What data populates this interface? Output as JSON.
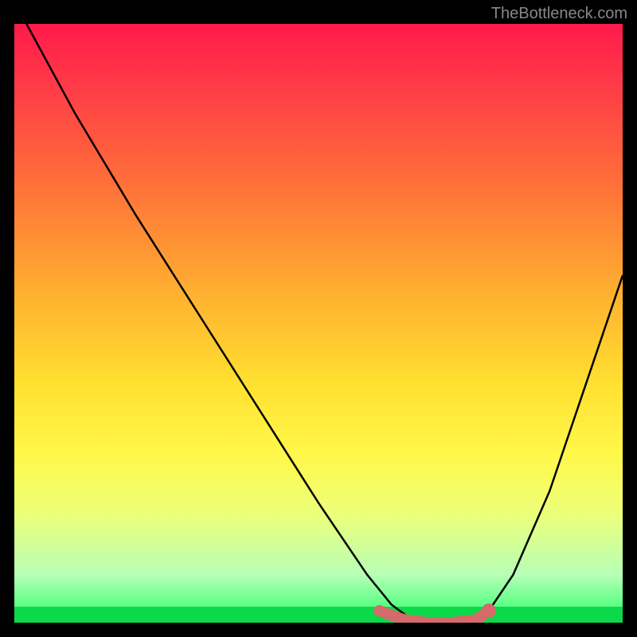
{
  "watermark": "TheBottleneck.com",
  "plot": {
    "x_range": [
      0,
      100
    ],
    "y_range": [
      0,
      100
    ],
    "gradient_stops": [
      {
        "pos": 0,
        "color": "#ff1a4a"
      },
      {
        "pos": 10,
        "color": "#ff3a48"
      },
      {
        "pos": 25,
        "color": "#ff6a3a"
      },
      {
        "pos": 45,
        "color": "#ffb030"
      },
      {
        "pos": 60,
        "color": "#ffe030"
      },
      {
        "pos": 72,
        "color": "#fff84a"
      },
      {
        "pos": 82,
        "color": "#ecff7a"
      },
      {
        "pos": 92,
        "color": "#b6ffb6"
      },
      {
        "pos": 100,
        "color": "#2aff6a"
      }
    ]
  },
  "chart_data": {
    "type": "line",
    "title": "",
    "xlabel": "",
    "ylabel": "",
    "xlim": [
      0,
      100
    ],
    "ylim": [
      0,
      100
    ],
    "series": [
      {
        "name": "curve",
        "x": [
          2,
          10,
          20,
          30,
          40,
          50,
          58,
          62,
          66,
          70,
          74,
          78,
          82,
          88,
          94,
          100
        ],
        "y": [
          100,
          85,
          68,
          52,
          36,
          20,
          8,
          3,
          0,
          0,
          0,
          2,
          8,
          22,
          40,
          58
        ]
      }
    ],
    "highlight": {
      "name": "optimal-zone",
      "color": "#d46a6a",
      "x": [
        60,
        64,
        68,
        72,
        76,
        78
      ],
      "y": [
        2,
        0.5,
        0,
        0,
        0.5,
        2
      ]
    }
  }
}
